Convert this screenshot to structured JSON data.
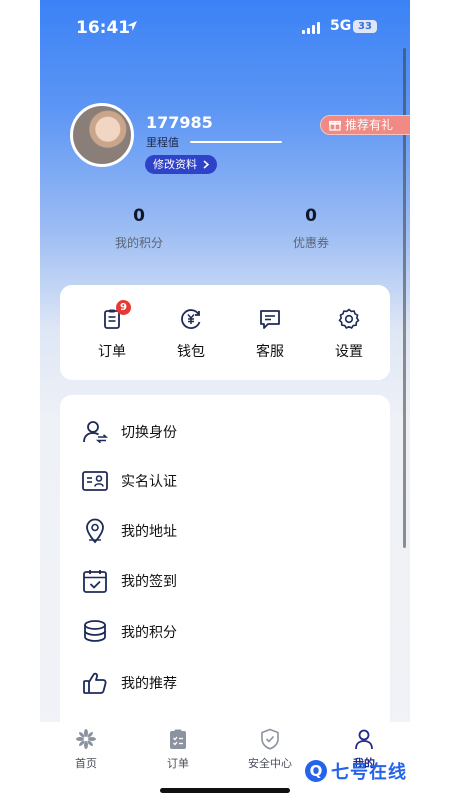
{
  "status_bar": {
    "time": "16:41",
    "network": "5G",
    "battery": "33"
  },
  "profile": {
    "user_id": "177985",
    "mileage_label": "里程值",
    "edit_profile_label": "修改资料",
    "recommend_gift_label": "推荐有礼"
  },
  "stats": [
    {
      "value": "0",
      "label": "我的积分"
    },
    {
      "value": "0",
      "label": "优惠券"
    }
  ],
  "quick_actions": [
    {
      "label": "订单",
      "icon": "order-clipboard-icon",
      "badge": "9"
    },
    {
      "label": "钱包",
      "icon": "wallet-yuan-icon"
    },
    {
      "label": "客服",
      "icon": "customer-service-chat-icon"
    },
    {
      "label": "设置",
      "icon": "settings-gear-icon"
    }
  ],
  "menu_items": [
    {
      "label": "切换身份",
      "icon": "switch-identity-icon"
    },
    {
      "label": "实名认证",
      "icon": "id-card-icon"
    },
    {
      "label": "我的地址",
      "icon": "location-pin-icon"
    },
    {
      "label": "我的签到",
      "icon": "calendar-checkin-icon"
    },
    {
      "label": "我的积分",
      "icon": "coins-stack-icon"
    },
    {
      "label": "我的推荐",
      "icon": "thumbs-up-icon"
    }
  ],
  "tab_bar": [
    {
      "label": "首页",
      "icon": "home-flower-icon"
    },
    {
      "label": "订单",
      "icon": "orders-clipboard-icon"
    },
    {
      "label": "安全中心",
      "icon": "shield-check-icon"
    },
    {
      "label": "我的",
      "icon": "profile-user-icon",
      "active": true
    }
  ],
  "watermark": {
    "text": "七号在线",
    "logo_letter": "Q"
  },
  "colors": {
    "header_blue": "#3b82f6",
    "accent_navy": "#2f43c8",
    "badge_red": "#e53935",
    "recommend_pink": "#ef8a84"
  }
}
